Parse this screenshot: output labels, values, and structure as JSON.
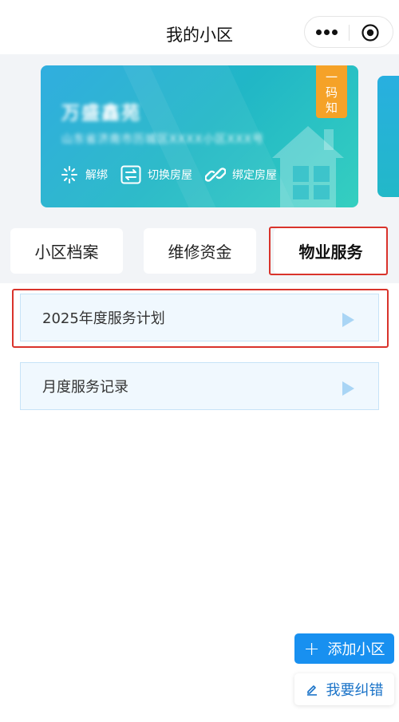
{
  "header": {
    "title": "我的小区",
    "menu_icon": "more-dots-icon",
    "close_icon": "target-circle-icon"
  },
  "card": {
    "community_name": "万盛鑫苑",
    "address": "山东省济南市历城区XXXX小区XXX号",
    "badge_line1": "一",
    "badge_line2": "码",
    "badge_line3": "知",
    "actions": [
      {
        "label": "解绑",
        "icon": "unbind-link-icon"
      },
      {
        "label": "切换房屋",
        "icon": "switch-arrows-icon"
      },
      {
        "label": "绑定房屋",
        "icon": "link-chain-icon"
      }
    ],
    "colors": {
      "gradient_start": "#24a9dd",
      "gradient_end": "#35cfc0",
      "badge": "#f5a228"
    }
  },
  "tabs": [
    {
      "label": "小区档案"
    },
    {
      "label": "维修资金"
    },
    {
      "label": "物业服务",
      "active": true
    }
  ],
  "list": [
    {
      "label": "2025年度服务计划"
    },
    {
      "label": "月度服务记录"
    }
  ],
  "fab": {
    "add_label": "添加小区",
    "correct_label": "我要纠错"
  },
  "colors": {
    "accent": "#1890f0",
    "highlight": "#d9332b"
  }
}
